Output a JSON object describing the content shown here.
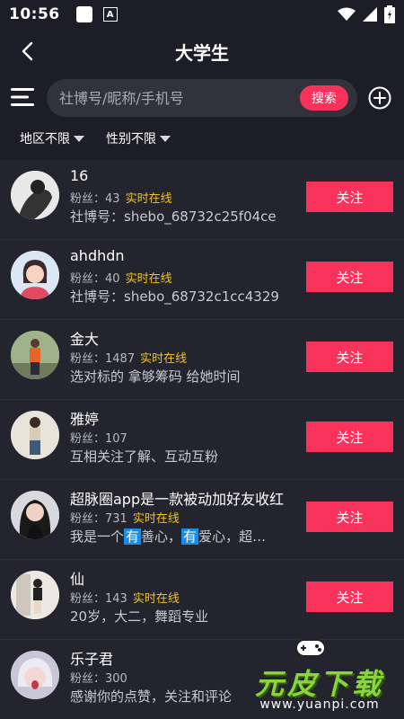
{
  "status_bar": {
    "time": "10:56",
    "a_badge": "A"
  },
  "header": {
    "title": "大学生"
  },
  "search": {
    "placeholder": "社博号/昵称/手机号",
    "button_label": "搜索"
  },
  "filters": [
    {
      "label": "地区不限"
    },
    {
      "label": "性别不限"
    }
  ],
  "users": [
    {
      "name": "16",
      "fans_label": "粉丝：",
      "fans": "43",
      "online": "实时在线",
      "desc": "社博号：shebo_68732c25f04ce",
      "follow": "关注"
    },
    {
      "name": "ahdhdn",
      "fans_label": "粉丝：",
      "fans": "40",
      "online": "实时在线",
      "desc": "社博号：shebo_68732c1cc4329",
      "follow": "关注"
    },
    {
      "name": "金大",
      "fans_label": "粉丝：",
      "fans": "1487",
      "online": "实时在线",
      "desc": "选对标的 拿够筹码 给她时间",
      "follow": "关注"
    },
    {
      "name": "雅婷",
      "fans_label": "粉丝：",
      "fans": "107",
      "online": "",
      "desc": "互相关注了解、互动互粉",
      "follow": "关注"
    },
    {
      "name": "超脉圈app是一款被动加好友收红",
      "fans_label": "粉丝：",
      "fans": "731",
      "online": "实时在线",
      "desc_parts": [
        "我是一个",
        "有",
        "善心，",
        "有",
        "爱心，超…"
      ],
      "follow": "关注"
    },
    {
      "name": "仙",
      "fans_label": "粉丝：",
      "fans": "143",
      "online": "实时在线",
      "desc": "20岁，大二，舞蹈专业",
      "follow": "关注"
    },
    {
      "name": "乐子君",
      "fans_label": "粉丝：",
      "fans": "300",
      "online": "",
      "desc": "感谢你的点赞，关注和评论",
      "follow": ""
    }
  ],
  "watermark": {
    "brand": "元皮下载",
    "url": "www.yuanpi.com"
  },
  "colors": {
    "accent": "#f8325b",
    "online": "#f0c220",
    "background": "#1d1d28",
    "list_bg": "#24242f"
  }
}
